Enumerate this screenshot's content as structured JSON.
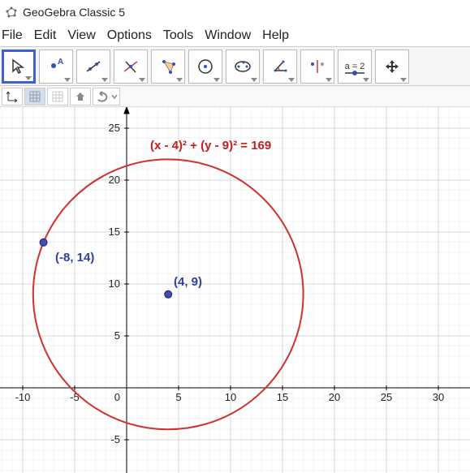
{
  "titlebar": {
    "title": "GeoGebra Classic 5"
  },
  "menubar": {
    "file": "File",
    "edit": "Edit",
    "view": "View",
    "options": "Options",
    "tools": "Tools",
    "window": "Window",
    "help": "Help"
  },
  "toolbar": {
    "slider_label": "a = 2"
  },
  "graph": {
    "equation_label": "(x - 4)² + (y - 9)² = 169",
    "center_label": "(4, 9)",
    "point_label": "(-8, 14)",
    "axis_labels": {
      "x": [
        "-10",
        "-5",
        "0",
        "5",
        "10",
        "15",
        "20",
        "25",
        "30"
      ],
      "y": [
        "-5",
        "5",
        "10",
        "15",
        "20",
        "25"
      ]
    }
  },
  "chart_data": {
    "type": "scatter",
    "title": "(x - 4)² + (y - 9)² = 169",
    "circle": {
      "center_x": 4,
      "center_y": 9,
      "radius": 13,
      "equation": "(x - 4)² + (y - 9)² = 169"
    },
    "points": [
      {
        "name": "center",
        "x": 4,
        "y": 9,
        "label": "(4, 9)"
      },
      {
        "name": "on_circle",
        "x": -8,
        "y": 14,
        "label": "(-8, 14)"
      }
    ],
    "xlabel": "",
    "ylabel": "",
    "xlim": [
      -12,
      32
    ],
    "ylim": [
      -8,
      27
    ],
    "grid": true
  }
}
